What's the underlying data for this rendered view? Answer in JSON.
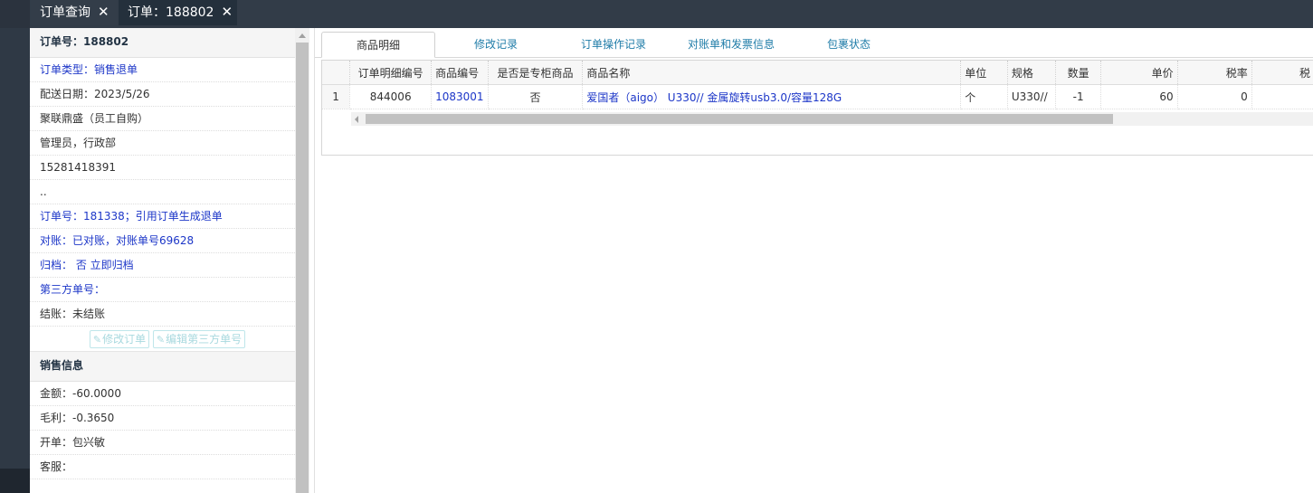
{
  "top_tabs": [
    {
      "label": "订单查询"
    },
    {
      "label": "订单：188802"
    }
  ],
  "order_info": {
    "header": "订单号：188802",
    "rows": [
      {
        "text": "订单类型：销售退单",
        "blue": true
      },
      {
        "text": "配送日期：2023/5/26",
        "blue": false
      },
      {
        "text": "聚联鼎盛（员工自购）",
        "blue": false
      },
      {
        "text": "管理员，行政部",
        "blue": false
      },
      {
        "text": "15281418391",
        "blue": false
      },
      {
        "text": "..",
        "blue": false
      },
      {
        "text": "订单号：181338；引用订单生成退单",
        "blue": true
      },
      {
        "text": "对账：已对账，对账单号69628",
        "blue": true
      },
      {
        "text": "归档：  否 立即归档",
        "blue": true
      },
      {
        "text": "第三方单号：",
        "blue": true
      },
      {
        "text": "结账：未结账",
        "blue": false
      }
    ],
    "buttons": {
      "edit_order": "修改订单",
      "edit_third_party": "编辑第三方单号"
    }
  },
  "sales_info": {
    "header": "销售信息",
    "rows": [
      {
        "text": "金额：-60.0000"
      },
      {
        "text": "毛利：-0.3650"
      },
      {
        "text": "开单：包兴敏"
      },
      {
        "text": "客服："
      }
    ]
  },
  "content_tabs": [
    {
      "label": "商品明细",
      "active": true
    },
    {
      "label": "修改记录",
      "active": false
    },
    {
      "label": "订单操作记录",
      "active": false
    },
    {
      "label": "对账单和发票信息",
      "active": false
    },
    {
      "label": "包裹状态",
      "active": false
    }
  ],
  "grid": {
    "columns": [
      "",
      "订单明细编号",
      "商品编号",
      "是否是专柜商品",
      "商品名称",
      "单位",
      "规格",
      "数量",
      "单价",
      "税率",
      "税"
    ],
    "rows": [
      {
        "rownum": "1",
        "detail_id": "844006",
        "product_id": "1083001",
        "is_counter": "否",
        "name": "爱国者（aigo） U330// 金属旋转usb3.0/容量128G",
        "unit": "个",
        "spec": "U330//",
        "qty": "-1",
        "price": "60",
        "tax_rate": "0",
        "tax": ""
      }
    ]
  },
  "icons": {
    "close": "close-icon",
    "edit": "edit-icon"
  },
  "colors": {
    "topbar": "#323c48",
    "link_blue": "#1c36c8",
    "tab_text": "#1f7ca8"
  }
}
